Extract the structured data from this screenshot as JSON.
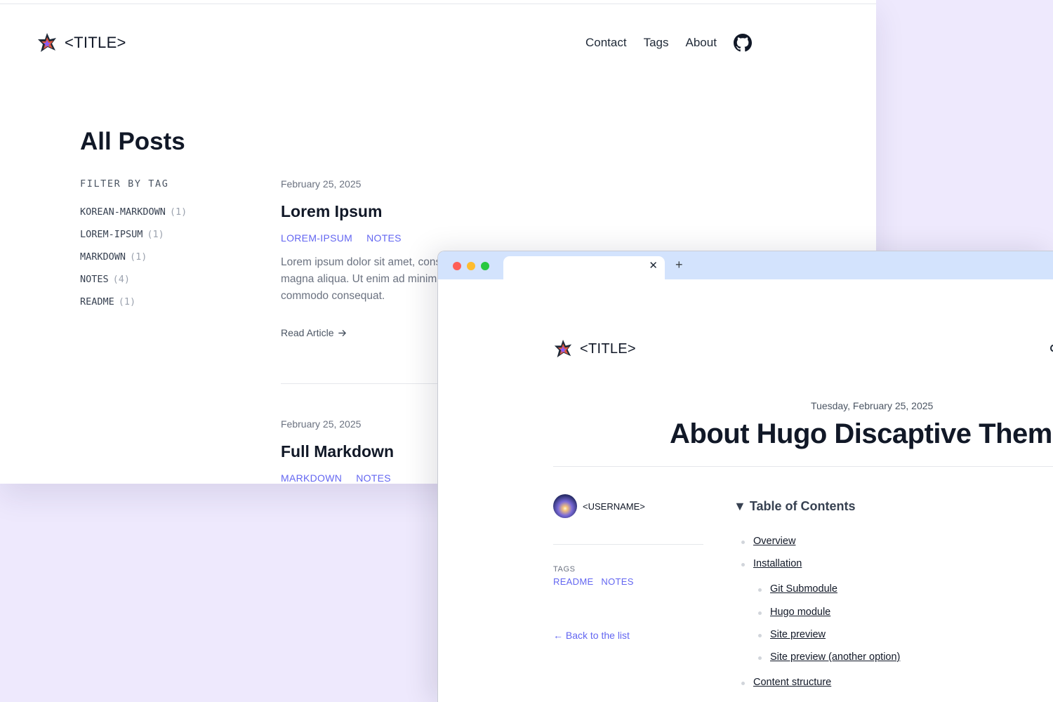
{
  "back_page": {
    "logo_title": "<TITLE>",
    "nav": [
      "Contact",
      "Tags",
      "About"
    ],
    "heading": "All Posts",
    "filter": {
      "label": "FILTER BY TAG",
      "tags": [
        {
          "name": "KOREAN-MARKDOWN",
          "count": "(1)"
        },
        {
          "name": "LOREM-IPSUM",
          "count": "(1)"
        },
        {
          "name": "MARKDOWN",
          "count": "(1)"
        },
        {
          "name": "NOTES",
          "count": "(4)"
        },
        {
          "name": "README",
          "count": "(1)"
        }
      ]
    },
    "posts": [
      {
        "date": "February 25, 2025",
        "title": "Lorem Ipsum",
        "tags": [
          "LOREM-IPSUM",
          "NOTES"
        ],
        "excerpt": "Lorem ipsum dolor sit amet, consectetur adipiscing elit, sed do eiusmod tempor incididunt ut labore et dolore magna aliqua. Ut enim ad minim veniam, quis nostrud exercitation ullamco laboris nisi ut aliquip ex ea commodo consequat.",
        "read_more": "Read Article"
      },
      {
        "date": "February 25, 2025",
        "title": "Full Markdown",
        "tags": [
          "MARKDOWN",
          "NOTES"
        ]
      }
    ]
  },
  "front_page": {
    "tab": {
      "close": "✕",
      "new_tab": "+"
    },
    "logo_title": "<TITLE>",
    "date": "Tuesday, February 25, 2025",
    "title": "About Hugo Discaptive Theme",
    "author": "<USERNAME>",
    "tags_label": "TAGS",
    "tags": [
      "README",
      "NOTES"
    ],
    "back_link": "← Back to the list",
    "toc": {
      "title": "▼ Table of Contents",
      "items": [
        "Overview",
        "Installation",
        "Git Submodule",
        "Hugo module",
        "Site preview",
        "Site preview (another option)",
        "Content structure"
      ]
    }
  },
  "colors": {
    "background": "#eee9fd",
    "accent": "#6366f1",
    "tabbar": "#d3e3fd",
    "traffic_red": "#ff5f57",
    "traffic_yellow": "#febc2e",
    "traffic_green": "#28c840"
  },
  "icons": [
    "star-logo-icon",
    "github-icon",
    "arrow-right-icon",
    "close-icon",
    "plus-icon"
  ]
}
